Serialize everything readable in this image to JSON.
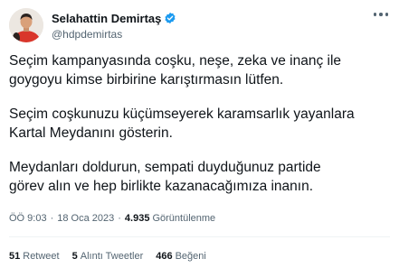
{
  "author": {
    "name": "Selahattin Demirtaş",
    "handle": "@hdpdemirtas",
    "verified_color": "#1d9bf0"
  },
  "tweet": {
    "paragraphs": [
      "Seçim kampanyasında coşku, neşe, zeka ve inanç ile\ngoygoyu kimse birbirine karıştırmasın lütfen.",
      "Seçim coşkunuzu küçümseyerek karamsarlık yayanlara\nKartal Meydanını gösterin.",
      "Meydanları doldurun, sempati duyduğunuz partide\ngörev alın ve hep birlikte kazanacağımıza inanın."
    ]
  },
  "meta": {
    "time": "ÖÖ 9:03",
    "date": "18 Oca 2023",
    "views_count": "4.935",
    "views_label": "Görüntülenme",
    "separator": "·"
  },
  "stats": {
    "retweets_count": "51",
    "retweets_label": "Retweet",
    "quotes_count": "5",
    "quotes_label": "Alıntı Tweetler",
    "likes_count": "466",
    "likes_label": "Beğeni"
  },
  "icons": {
    "verified": "verified-badge-icon",
    "more": "more-options-icon"
  }
}
